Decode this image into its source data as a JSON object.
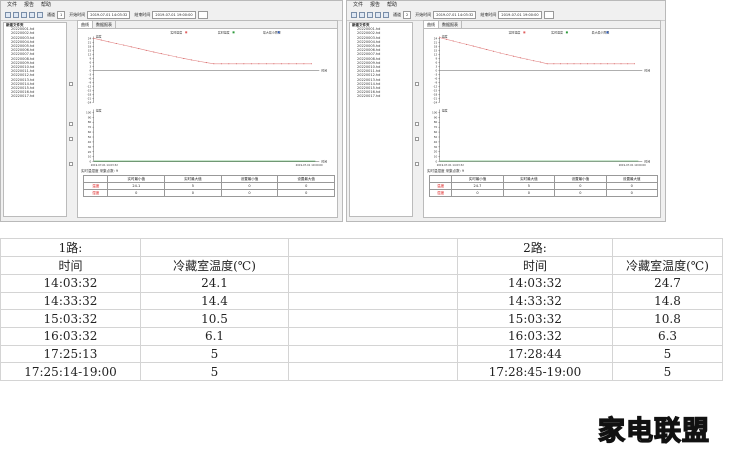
{
  "windows": [
    {
      "menu": [
        "文件",
        "报告",
        "帮助"
      ],
      "toolbar": {
        "channel_label": "通道",
        "channel_value": "1",
        "start_label": "开始时间",
        "start_value": "2019-07-01 14:03:32",
        "end_label": "结束时间",
        "end_value": "2019-07-01 19:00:00"
      },
      "tree": {
        "root": "新建文件夹",
        "files": [
          "20220001.hd",
          "20220002.hd",
          "20220003.hd",
          "20220004.hd",
          "20220005.hd",
          "20220006.hd",
          "20220007.hd",
          "20220008.hd",
          "20220009.hd",
          "20220010.hd",
          "20220011.hd",
          "20220012.hd",
          "20220013.hd",
          "20220014.hd",
          "20220015.hd",
          "20220016.hd",
          "20220017.hd"
        ]
      },
      "tabs": [
        "曲线",
        "数据报表"
      ],
      "legend": [
        "实时温度",
        "实时湿度",
        "最大最小界限"
      ],
      "temp_axis": {
        "label": "温度",
        "ticks": [
          "24",
          "21",
          "18",
          "15",
          "12",
          "9",
          "6",
          "3",
          "0",
          "-3",
          "-6",
          "-9",
          "-12",
          "-15",
          "-18",
          "-21",
          "-24"
        ],
        "x_unit": "时间"
      },
      "hum_axis": {
        "label": "湿度",
        "ticks": [
          "100",
          "90",
          "80",
          "70",
          "60",
          "50",
          "40",
          "30",
          "20",
          "10",
          "0"
        ],
        "x_unit": "时间"
      },
      "x_start": "2019-07-01 14:03:32",
      "x_end": "2019-07-01 19:00:00",
      "caption": "实时温湿度  采集点数: 9",
      "stats": {
        "headers": [
          "",
          "实时最小值",
          "实时最大值",
          "设置最小值",
          "设置最大值"
        ],
        "rows": [
          [
            "温度",
            "24.1",
            "5",
            "0",
            "0"
          ],
          [
            "湿度",
            "0",
            "0",
            "0",
            "0"
          ]
        ]
      }
    },
    {
      "menu": [
        "文件",
        "报告",
        "帮助"
      ],
      "toolbar": {
        "channel_label": "通道",
        "channel_value": "2",
        "start_label": "开始时间",
        "start_value": "2019-07-01 14:03:32",
        "end_label": "结束时间",
        "end_value": "2019-07-01 19:00:00"
      },
      "tree": {
        "root": "新建文件夹",
        "files": [
          "20220001.hd",
          "20220002.hd",
          "20220003.hd",
          "20220004.hd",
          "20220005.hd",
          "20220006.hd",
          "20220007.hd",
          "20220008.hd",
          "20220009.hd",
          "20220010.hd",
          "20220011.hd",
          "20220012.hd",
          "20220013.hd",
          "20220014.hd",
          "20220015.hd",
          "20220016.hd",
          "20220017.hd"
        ]
      },
      "tabs": [
        "曲线",
        "数据报表"
      ],
      "legend": [
        "实时温度",
        "实时湿度",
        "最大最小界限"
      ],
      "temp_axis": {
        "label": "温度",
        "ticks": [
          "24",
          "21",
          "18",
          "15",
          "12",
          "9",
          "6",
          "3",
          "0",
          "-3",
          "-6",
          "-9",
          "-12",
          "-15",
          "-18",
          "-21",
          "-24"
        ],
        "x_unit": "时间"
      },
      "hum_axis": {
        "label": "湿度",
        "ticks": [
          "100",
          "90",
          "80",
          "70",
          "60",
          "50",
          "40",
          "30",
          "20",
          "10",
          "0"
        ],
        "x_unit": "时间"
      },
      "x_start": "2019-07-01 14:03:32",
      "x_end": "2019-07-01 19:00:00",
      "caption": "实时温湿度  采集点数: 9",
      "stats": {
        "headers": [
          "",
          "实时最小值",
          "实时最大值",
          "设置最小值",
          "设置最大值"
        ],
        "rows": [
          [
            "温度",
            "24.7",
            "5",
            "0",
            "0"
          ],
          [
            "湿度",
            "0",
            "0",
            "0",
            "0"
          ]
        ]
      }
    }
  ],
  "chart_data": [
    {
      "type": "line",
      "series": [
        {
          "values": [
            24.1,
            22.8,
            21.5,
            20.2,
            19.0,
            17.7,
            16.4,
            15.1,
            13.8,
            12.6,
            11.4,
            10.2,
            9.0,
            7.9,
            6.9,
            5.9,
            5.0,
            5,
            5,
            5,
            5,
            5,
            5,
            5,
            5,
            5,
            5,
            5,
            5,
            5
          ]
        }
      ],
      "ylim": [
        -24,
        24
      ]
    },
    {
      "type": "line",
      "series": [
        {
          "values": [
            24.7,
            23.4,
            22.1,
            20.8,
            19.6,
            18.3,
            17.0,
            15.7,
            14.4,
            13.1,
            11.9,
            10.7,
            9.5,
            8.4,
            7.3,
            6.3,
            5.0,
            5,
            5,
            5,
            5,
            5,
            5,
            5,
            5,
            5,
            5,
            5,
            5,
            5
          ]
        }
      ],
      "ylim": [
        -24,
        24
      ]
    }
  ],
  "table": {
    "left": {
      "title": "1路:",
      "col_time": "时间",
      "col_temp": "冷藏室温度(℃)",
      "rows": [
        [
          "14:03:32",
          "24.1"
        ],
        [
          "14:33:32",
          "14.4"
        ],
        [
          "15:03:32",
          "10.5"
        ],
        [
          "16:03:32",
          "6.1"
        ],
        [
          "17:25:13",
          "5"
        ],
        [
          "17:25:14-19:00",
          "5"
        ]
      ]
    },
    "right": {
      "title": "2路:",
      "col_time": "时间",
      "col_temp": "冷藏室温度(℃)",
      "rows": [
        [
          "14:03:32",
          "24.7"
        ],
        [
          "14:33:32",
          "14.8"
        ],
        [
          "15:03:32",
          "10.8"
        ],
        [
          "16:03:32",
          "6.3"
        ],
        [
          "17:28:44",
          "5"
        ],
        [
          "17:28:45-19:00",
          "5"
        ]
      ]
    }
  },
  "brand": "家电联盟"
}
